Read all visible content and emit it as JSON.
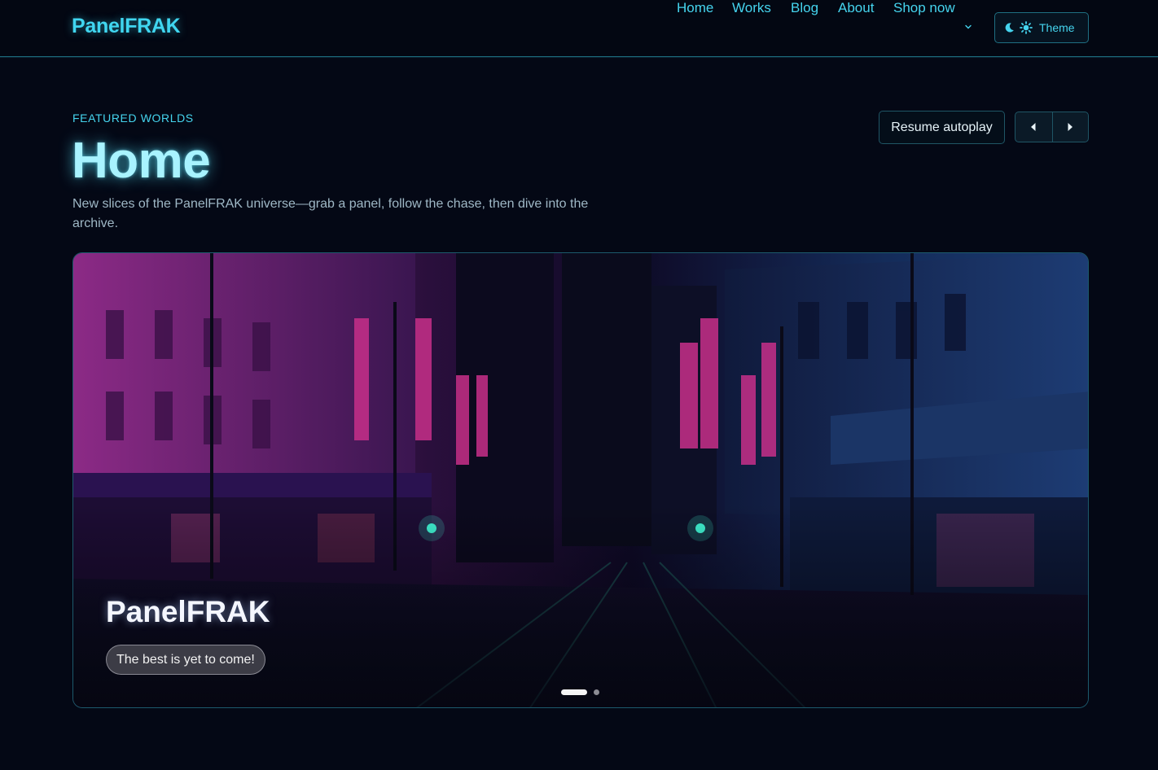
{
  "header": {
    "brand": "PanelFRAK",
    "nav": [
      {
        "label": "Home"
      },
      {
        "label": "Works"
      },
      {
        "label": "Blog"
      },
      {
        "label": "About"
      },
      {
        "label": "Shop now",
        "has_dropdown": true
      }
    ],
    "theme_button": {
      "label": "Theme",
      "icons": [
        "moon-icon",
        "sun-icon"
      ]
    }
  },
  "hero": {
    "eyebrow": "FEATURED WORLDS",
    "title": "Home",
    "subtitle": "New slices of the PanelFRAK universe—grab a panel, follow the chase, then dive into the archive.",
    "resume_label": "Resume autoplay",
    "prev_icon": "caret-left-icon",
    "next_icon": "caret-right-icon"
  },
  "carousel": {
    "slide_title": "PanelFRAK",
    "slide_button": "The best is yet to come!",
    "slides_total": 2,
    "active_slide": 1
  },
  "colors": {
    "background": "#040815",
    "accent": "#45d4ee",
    "title_glow": "#a8f3ff"
  }
}
